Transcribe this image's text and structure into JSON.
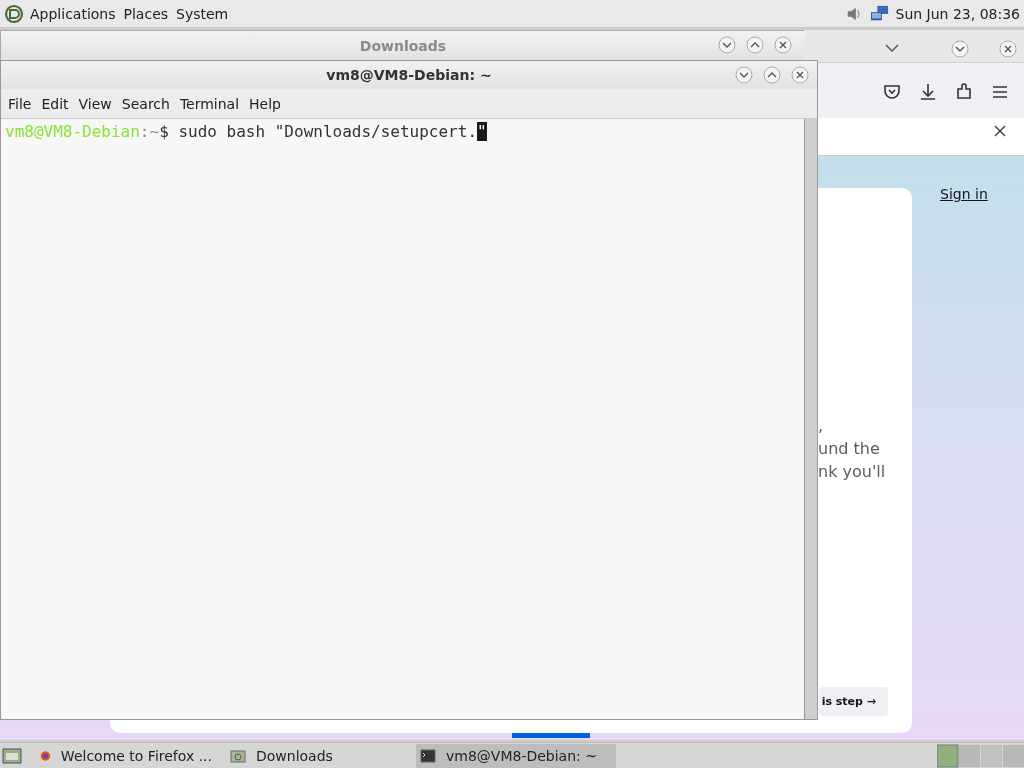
{
  "top_panel": {
    "menus": [
      "Applications",
      "Places",
      "System"
    ],
    "clock": "Sun Jun 23, 08:36"
  },
  "firefox": {
    "sign_in": "Sign in",
    "text_fragments": [
      ",",
      "und the",
      "nk you'll"
    ],
    "button": "is step →"
  },
  "downloads_window": {
    "title": "Downloads",
    "active": false
  },
  "terminal": {
    "title": "vm8@VM8-Debian: ~",
    "active": true,
    "menu": [
      "File",
      "Edit",
      "View",
      "Search",
      "Terminal",
      "Help"
    ],
    "prompt": {
      "user_host": "vm8@VM8-Debian",
      "path": ":~",
      "symbol": "$"
    },
    "command": " sudo bash \"Downloads/setupcert.",
    "cursor_char": "\""
  },
  "taskbar": {
    "items": [
      {
        "label": "Welcome to Firefox ...",
        "kind": "firefox",
        "selected": false
      },
      {
        "label": "Downloads",
        "kind": "folder",
        "selected": false
      },
      {
        "label": "vm8@VM8-Debian: ~",
        "kind": "terminal",
        "selected": true
      }
    ]
  }
}
